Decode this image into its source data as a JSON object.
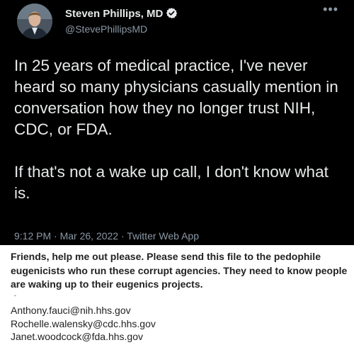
{
  "tweet": {
    "author": {
      "display_name": "Steven Phillips, MD",
      "handle": "@StevePhillipsMD",
      "verified": true
    },
    "paragraphs": [
      "In 25 years of medical practice, I've never heard so many physicians casually mention in conversation how they no longer trust NIH, CDC, or FDA.",
      "If that's not a wake up call, I don't know what is."
    ],
    "time": "9:12 PM",
    "date": "Mar 26, 2022",
    "source": "Twitter Web App",
    "separator": "·",
    "more_icon": "more-icon",
    "colors": {
      "background": "#000000",
      "text": "#e7e9ea",
      "secondary": "#8b98a5",
      "verified": "#e7e9ea"
    }
  },
  "attachment": {
    "message": "Friends, help me out please. Please send this file to the pedophile eugenicists who run these corrupt agencies. They need to know people are waking up to their eugenics projects.",
    "bullet": "-",
    "emails": [
      "Anthony.fauci@nih.hhs.gov",
      "Rochelle.walensky@cdc.hhs.gov",
      "Janet.woodcock@fda.hhs.gov"
    ]
  }
}
